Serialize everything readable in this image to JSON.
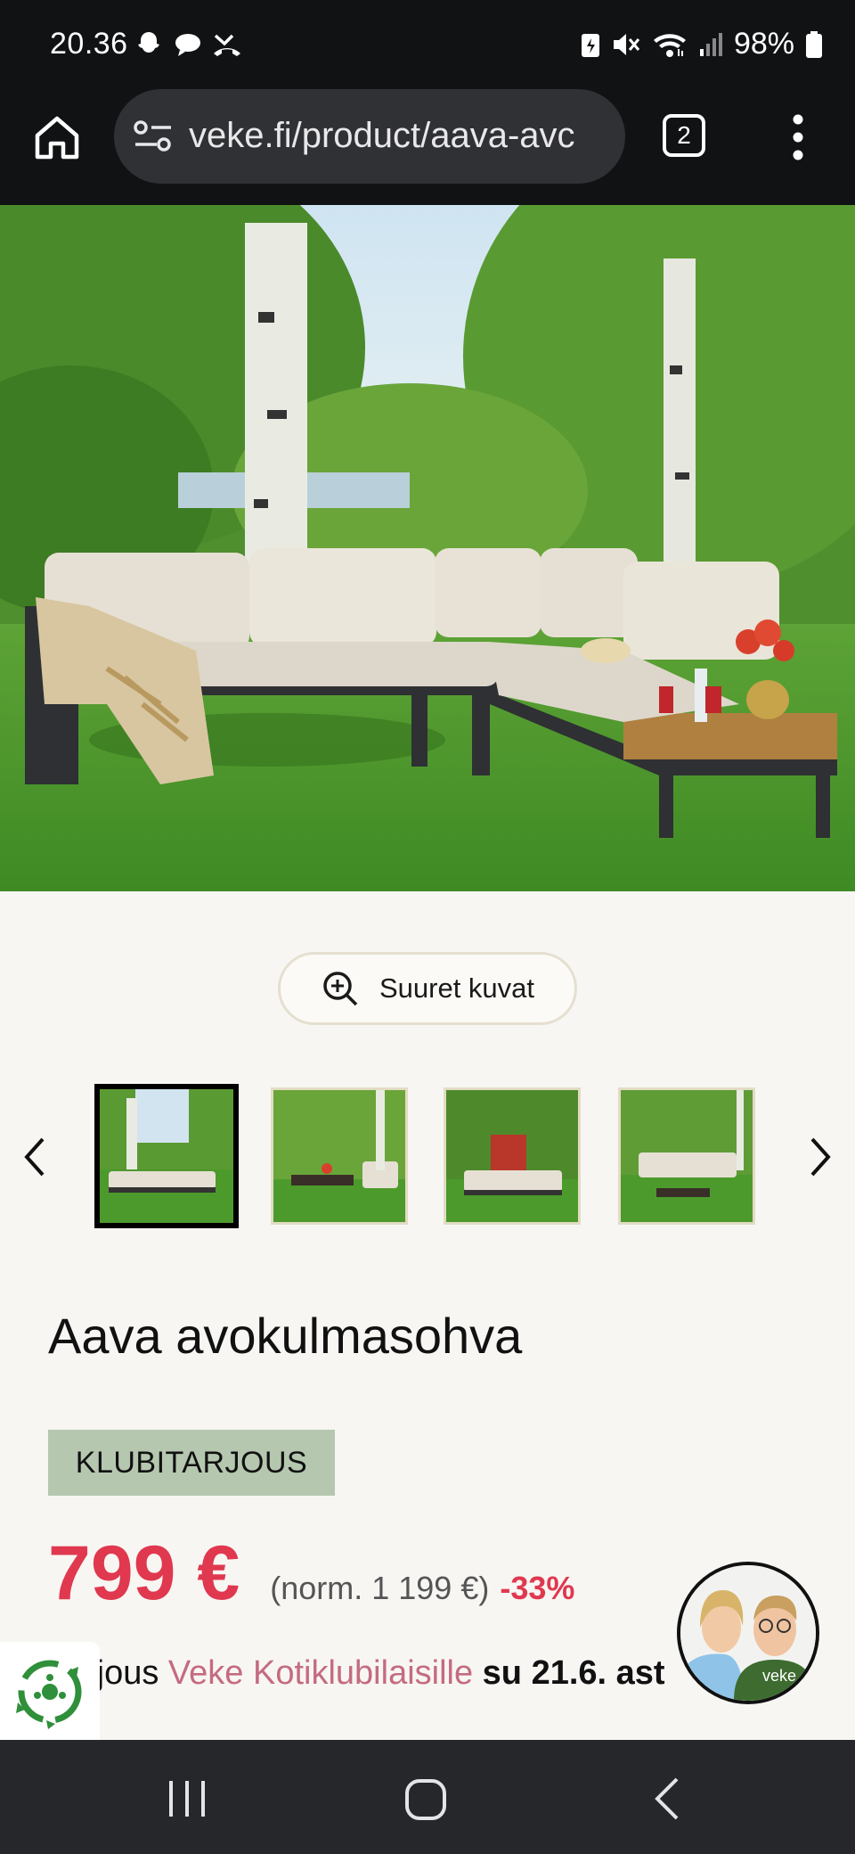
{
  "status_bar": {
    "time": "20.36",
    "battery": "98%",
    "icons": [
      "snapchat-icon",
      "chat-icon",
      "missed-call-icon",
      "battery-saver-icon",
      "mute-icon",
      "wifi-icon",
      "signal-icon",
      "battery-icon"
    ]
  },
  "browser": {
    "url": "veke.fi/product/aava-avc",
    "tab_count": "2"
  },
  "gallery": {
    "zoom_label": "Suuret kuvat",
    "thumbnails": [
      "thumb-1",
      "thumb-2",
      "thumb-3",
      "thumb-4"
    ]
  },
  "product": {
    "title": "Aava avokulmasohva",
    "badge": "KLUBITARJOUS",
    "price": "799 €",
    "normal_price": "(norm. 1 199 €)",
    "discount": "-33%",
    "offer_prefix": "rjous ",
    "offer_club": "Veke Kotiklubilaisille",
    "offer_date": " su 21.6. ast"
  },
  "colors": {
    "price_red": "#e0384f",
    "badge_green": "#b6c7b0",
    "club_pink": "#c56b7f"
  }
}
